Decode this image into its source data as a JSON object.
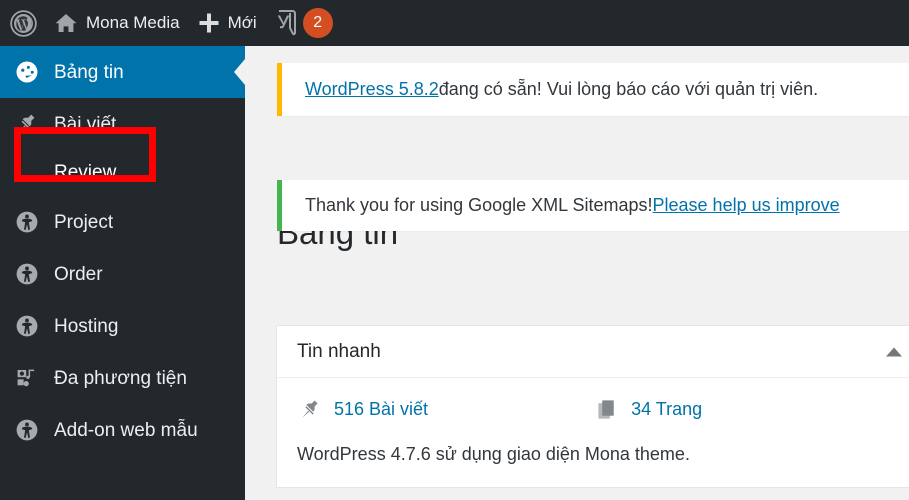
{
  "adminbar": {
    "wp_logo_name": "wordpress-logo",
    "site_name": "Mona Media",
    "new_label": "Mới",
    "yoast_name": "yoast-seo-icon",
    "badge_count": "2",
    "badge_color": "#d54e21",
    "background": "#23282d"
  },
  "sidebar": {
    "background": "#23282d",
    "active_color": "#0073aa",
    "items": [
      {
        "label": "Bảng tin",
        "icon": "dashboard-icon",
        "current": true
      },
      {
        "label": "Bài viết",
        "icon": "pin-icon",
        "current": false
      },
      {
        "label": "Review",
        "icon": "submenu",
        "current": false
      },
      {
        "label": "Project",
        "icon": "person-icon",
        "current": false
      },
      {
        "label": "Order",
        "icon": "person-icon",
        "current": false
      },
      {
        "label": "Hosting",
        "icon": "person-icon",
        "current": false
      },
      {
        "label": "Đa phương tiện",
        "icon": "media-icon",
        "current": false
      },
      {
        "label": "Add-on web mẫu",
        "icon": "person-icon",
        "current": false
      }
    ]
  },
  "annotation": {
    "target": "Bài viết",
    "color": "#ff0000"
  },
  "content": {
    "notices": [
      {
        "link_text": "WordPress 5.8.2",
        "text": " đang có sẵn! Vui lòng báo cáo với quản trị viên.",
        "accent": "#ffb900"
      },
      {
        "text": "Thank you for using Google XML Sitemaps! ",
        "link_text": "Please help us improve ",
        "accent": "#46b450"
      }
    ],
    "page_title": "Bảng tin",
    "glance_panel": {
      "title": "Tin nhanh",
      "toggle_icon": "chevron-up-icon",
      "posts": {
        "icon": "pin-icon",
        "label": "516 Bài viết"
      },
      "pages": {
        "icon": "pages-icon",
        "label": "34 Trang"
      },
      "version_note": "WordPress 4.7.6 sử dụng giao diện Mona theme."
    }
  }
}
